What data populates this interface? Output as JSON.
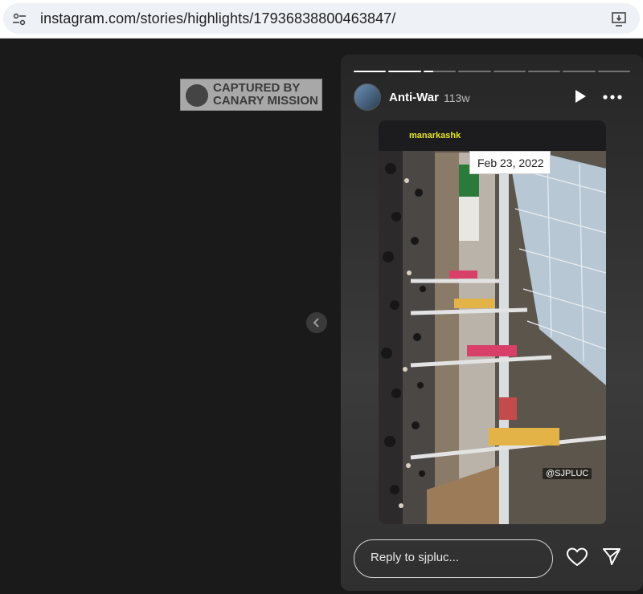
{
  "browser": {
    "url": "instagram.com/stories/highlights/17936838800463847/",
    "site_icon": "tune-icon",
    "install_icon": "install-app-icon"
  },
  "watermark": {
    "line1": "CAPTURED BY",
    "line2": "CANARY MISSION"
  },
  "story": {
    "username": "Anti-War",
    "age": "113w",
    "progress": {
      "segments": 8,
      "completed": 2,
      "current_fraction": 0.3
    },
    "media_tag": "manarkashk",
    "media_handle": "@SJPLUC",
    "date_tooltip": "Feb 23, 2022",
    "reply_placeholder": "Reply to sjpluc...",
    "icons": [
      "play-icon",
      "more-icon",
      "heart-icon",
      "send-icon",
      "chevron-left-icon"
    ]
  },
  "colors": {
    "page_bg": "#1a1a1a",
    "story_bg": "#2f2f2f",
    "tag_yellow": "#e6e617"
  }
}
